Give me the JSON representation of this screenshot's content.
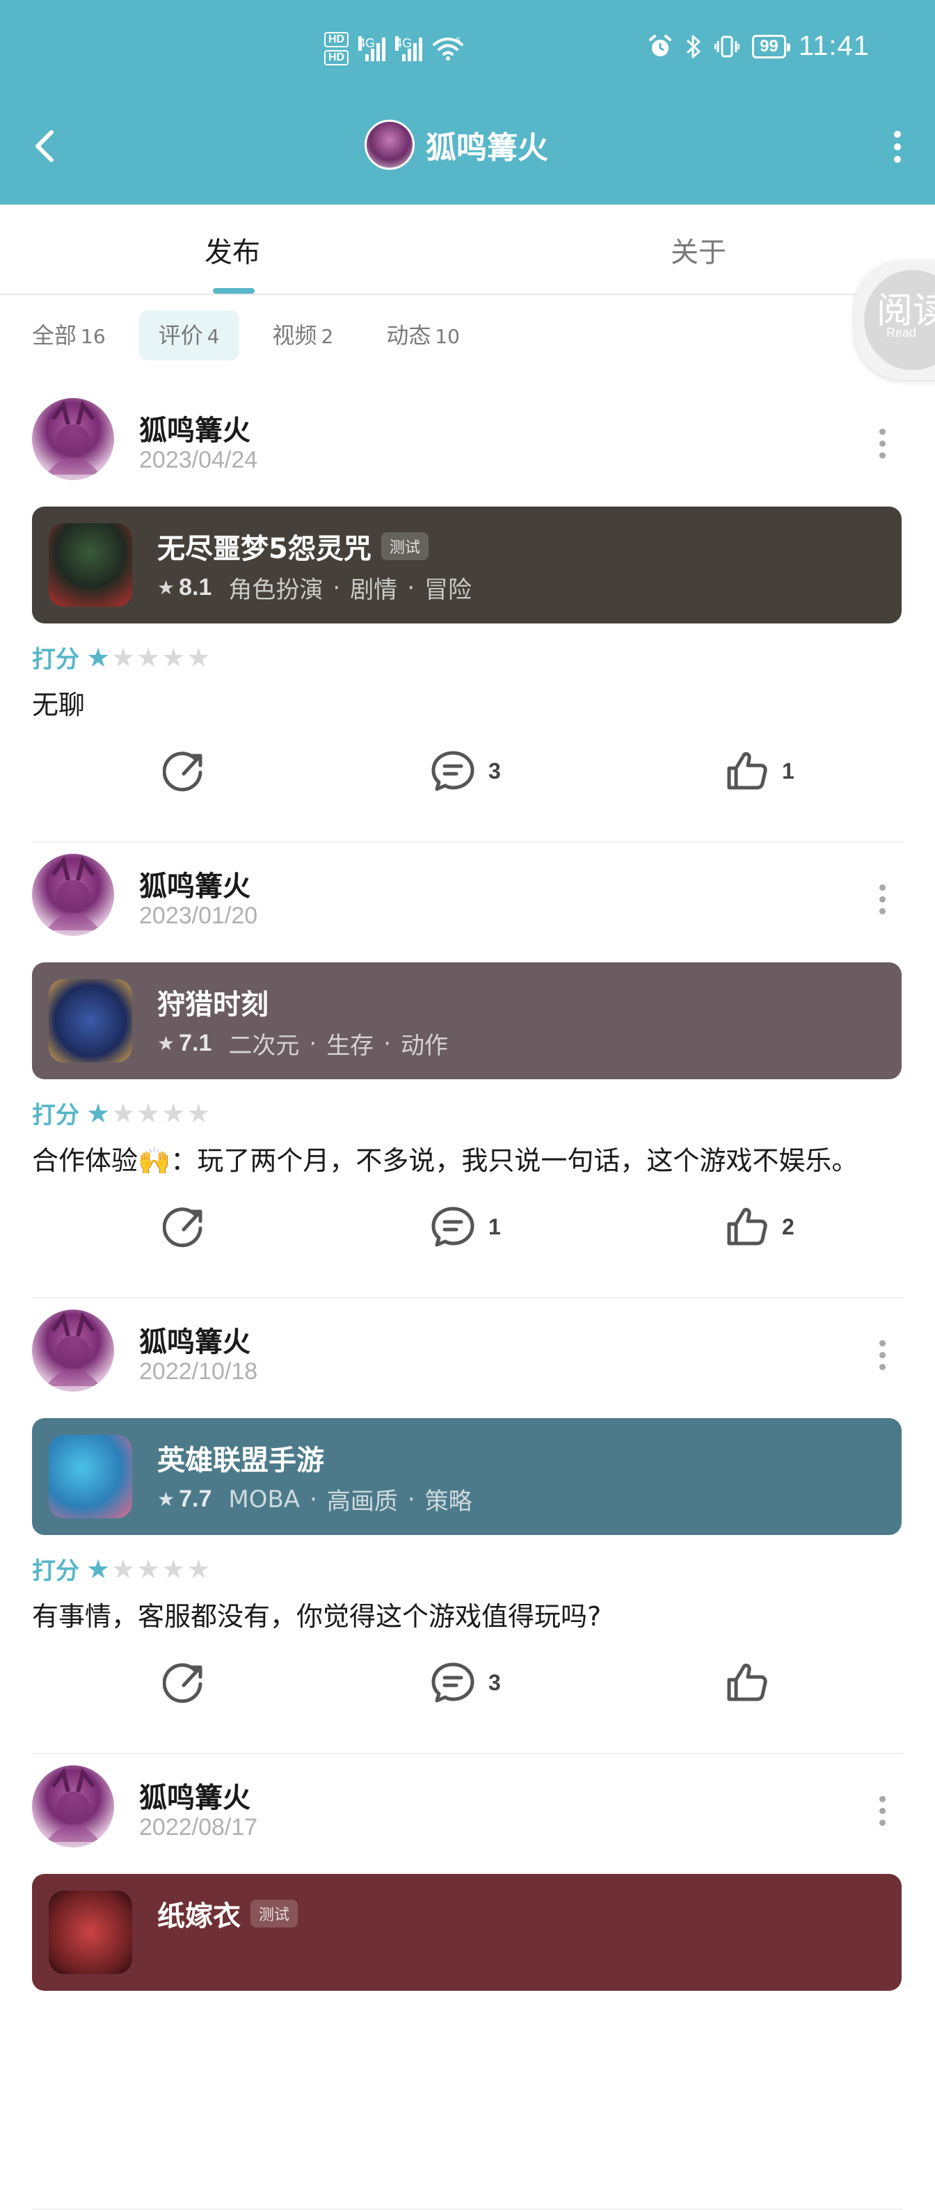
{
  "status_bar": {
    "hd1": "HD",
    "hd2": "HD",
    "net1": "4G",
    "net2": "4G",
    "wifi_gen": "6",
    "battery": "99",
    "time": "11:41"
  },
  "nav": {
    "title": "狐鸣篝火"
  },
  "tabs": [
    {
      "label": "发布"
    },
    {
      "label": "关于"
    }
  ],
  "read_badge": {
    "text": "阅读",
    "sub": "Read"
  },
  "filters": [
    {
      "label": "全部",
      "count": "16"
    },
    {
      "label": "评价",
      "count": "4"
    },
    {
      "label": "视频",
      "count": "2"
    },
    {
      "label": "动态",
      "count": "10"
    }
  ],
  "rating_label": "打分",
  "posts": [
    {
      "author": "狐鸣篝火",
      "date": "2023/04/24",
      "game": {
        "name": "无尽噩梦5怨灵咒",
        "tag": "测试",
        "score": "8.1",
        "genres": [
          "角色扮演",
          "剧情",
          "冒险"
        ],
        "card_color": "#45413a"
      },
      "stars": 1,
      "text": "无聊",
      "comments": "3",
      "likes": "1"
    },
    {
      "author": "狐鸣篝火",
      "date": "2023/01/20",
      "game": {
        "name": "狩猎时刻",
        "tag": "",
        "score": "7.1",
        "genres": [
          "二次元",
          "生存",
          "动作"
        ],
        "card_color": "#6a5c61"
      },
      "stars": 1,
      "text": "合作体验🙌：玩了两个月，不多说，我只说一句话，这个游戏不娱乐。",
      "comments": "1",
      "likes": "2"
    },
    {
      "author": "狐鸣篝火",
      "date": "2022/10/18",
      "game": {
        "name": "英雄联盟手游",
        "tag": "",
        "score": "7.7",
        "genres": [
          "MOBA",
          "高画质",
          "策略"
        ],
        "card_color": "#4c7a8a"
      },
      "stars": 1,
      "text": "有事情，客服都没有，你觉得这个游戏值得玩吗?",
      "comments": "3",
      "likes": ""
    },
    {
      "author": "狐鸣篝火",
      "date": "2022/08/17",
      "game": {
        "name": "纸嫁衣",
        "tag": "测试",
        "score": "",
        "genres": [],
        "card_color": "#6e3036"
      },
      "stars": 0,
      "text": "",
      "comments": "",
      "likes": ""
    }
  ],
  "colors": {
    "accent": "#57b6c8",
    "header_bg": "#57b6c8"
  }
}
